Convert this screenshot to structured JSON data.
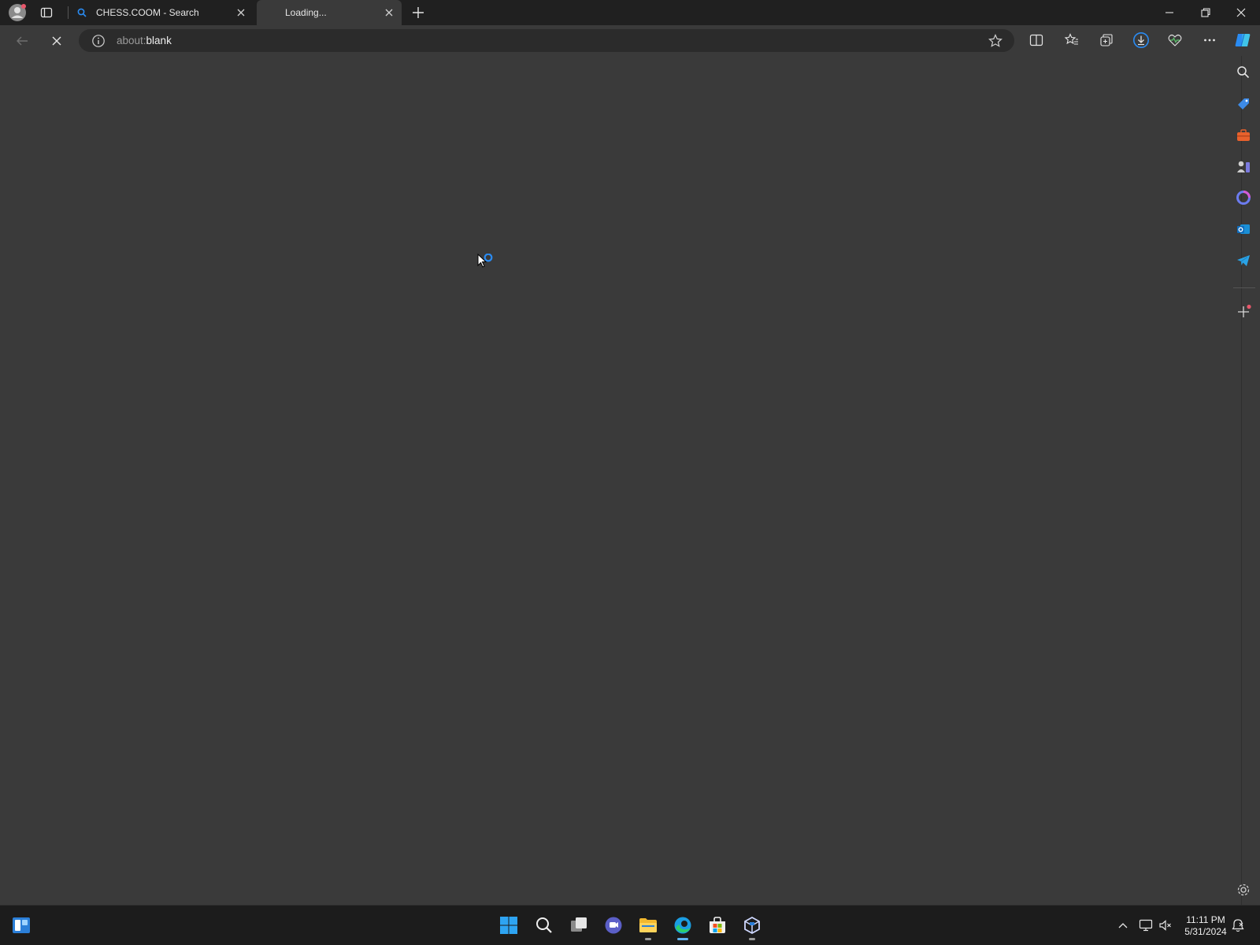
{
  "browser": {
    "tabs": [
      {
        "title": "CHESS.COOM - Search",
        "icon": "search-icon",
        "active": false
      },
      {
        "title": "Loading...",
        "icon": "",
        "active": true
      }
    ],
    "address": {
      "prefix": "about:",
      "host": "blank"
    },
    "accent": "#2a8bf2"
  },
  "sidebar": {
    "items": [
      "search-icon",
      "shopping-tag-icon",
      "tools-icon",
      "games-icon",
      "copilot-icon",
      "outlook-icon",
      "telegram-icon"
    ],
    "add_label": "+"
  },
  "taskbar": {
    "clock": {
      "time": "11:11 PM",
      "date": "5/31/2024"
    }
  }
}
